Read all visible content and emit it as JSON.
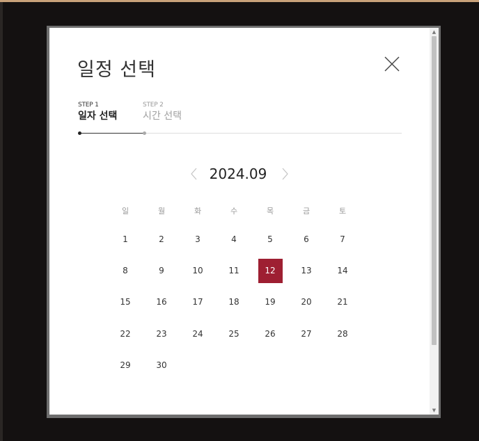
{
  "colors": {
    "accent": "#9e1f32",
    "background": "#141111",
    "modal": "#ffffff"
  },
  "modal": {
    "title": "일정 선택",
    "close_icon": "close-icon"
  },
  "steps": [
    {
      "number": "STEP 1",
      "label": "일자 선택",
      "active": true
    },
    {
      "number": "STEP 2",
      "label": "시간 선택",
      "active": false
    }
  ],
  "calendar": {
    "month_label": "2024.09",
    "prev_icon": "chevron-left-icon",
    "next_icon": "chevron-right-icon",
    "weekdays": [
      "일",
      "월",
      "화",
      "수",
      "목",
      "금",
      "토"
    ],
    "weeks": [
      [
        "1",
        "2",
        "3",
        "4",
        "5",
        "6",
        "7"
      ],
      [
        "8",
        "9",
        "10",
        "11",
        "12",
        "13",
        "14"
      ],
      [
        "15",
        "16",
        "17",
        "18",
        "19",
        "20",
        "21"
      ],
      [
        "22",
        "23",
        "24",
        "25",
        "26",
        "27",
        "28"
      ],
      [
        "29",
        "30",
        "",
        "",
        "",
        "",
        ""
      ]
    ],
    "selected_day": "12"
  }
}
